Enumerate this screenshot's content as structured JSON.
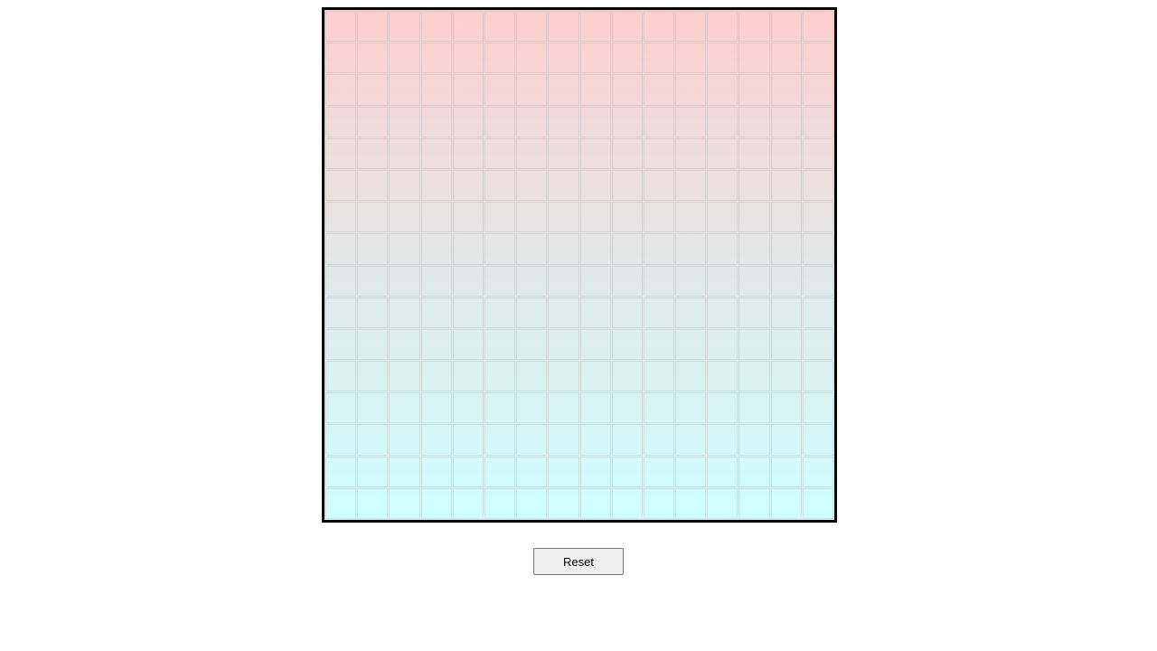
{
  "board": {
    "rows": 16,
    "columns": 16,
    "colors": {
      "top": "#ffcccc",
      "middle": "#e4e4e4",
      "bottom": "#ccffff",
      "border": "#000000"
    }
  },
  "controls": {
    "reset_label": "Reset"
  }
}
